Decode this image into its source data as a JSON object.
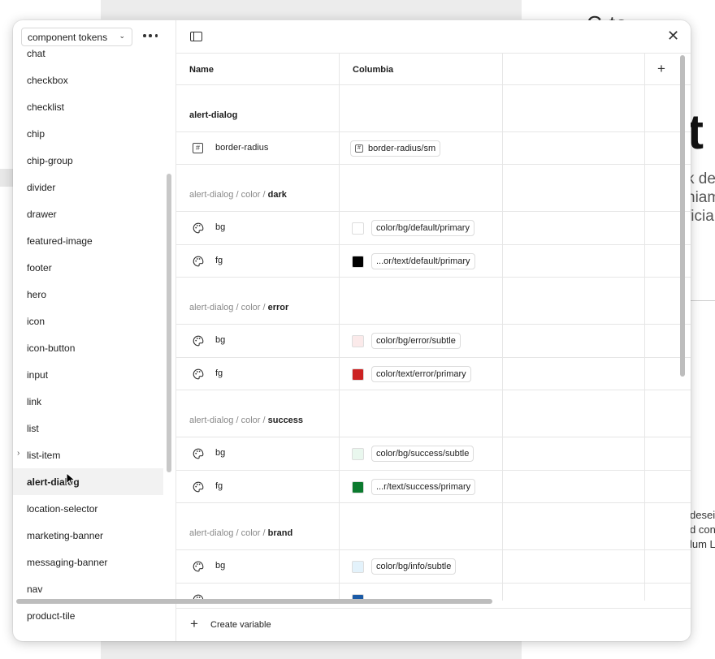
{
  "background": {
    "title": "C          ts",
    "big_char": "t",
    "desc_lines": [
      "k de",
      "niam",
      "ficia"
    ],
    "small_lines": [
      "desei",
      "d con",
      "lum L"
    ]
  },
  "sidebar": {
    "collection": "component tokens",
    "groups": [
      {
        "label": "chat"
      },
      {
        "label": "checkbox"
      },
      {
        "label": "checklist"
      },
      {
        "label": "chip"
      },
      {
        "label": "chip-group"
      },
      {
        "label": "divider"
      },
      {
        "label": "drawer"
      },
      {
        "label": "featured-image"
      },
      {
        "label": "footer"
      },
      {
        "label": "hero"
      },
      {
        "label": "icon"
      },
      {
        "label": "icon-button"
      },
      {
        "label": "input"
      },
      {
        "label": "link"
      },
      {
        "label": "list"
      },
      {
        "label": "list-item",
        "expandable": true
      },
      {
        "label": "alert-dialog",
        "active": true
      },
      {
        "label": "location-selector"
      },
      {
        "label": "marketing-banner"
      },
      {
        "label": "messaging-banner"
      },
      {
        "label": "nav"
      },
      {
        "label": "product-tile"
      }
    ]
  },
  "table": {
    "columns": [
      "Name",
      "Columbia"
    ],
    "groups": [
      {
        "title_prefix": "",
        "title_bold": "alert-dialog",
        "rows": [
          {
            "name": "border-radius",
            "type": "number",
            "value": "border-radius/sm"
          }
        ]
      },
      {
        "title_prefix": "alert-dialog / color / ",
        "title_bold": "dark",
        "rows": [
          {
            "name": "bg",
            "type": "color",
            "value": "color/bg/default/primary",
            "swatch": "#ffffff"
          },
          {
            "name": "fg",
            "type": "color",
            "value": "...or/text/default/primary",
            "swatch": "#000000"
          }
        ]
      },
      {
        "title_prefix": "alert-dialog / color / ",
        "title_bold": "error",
        "rows": [
          {
            "name": "bg",
            "type": "color",
            "value": "color/bg/error/subtle",
            "swatch": "#fbeaea"
          },
          {
            "name": "fg",
            "type": "color",
            "value": "color/text/error/primary",
            "swatch": "#cc2222"
          }
        ]
      },
      {
        "title_prefix": "alert-dialog / color / ",
        "title_bold": "success",
        "rows": [
          {
            "name": "bg",
            "type": "color",
            "value": "color/bg/success/subtle",
            "swatch": "#e9f7ee"
          },
          {
            "name": "fg",
            "type": "color",
            "value": "...r/text/success/primary",
            "swatch": "#0b7a2e"
          }
        ]
      },
      {
        "title_prefix": "alert-dialog / color / ",
        "title_bold": "brand",
        "rows": [
          {
            "name": "bg",
            "type": "color",
            "value": "color/bg/info/subtle",
            "swatch": "#e3f2fb"
          },
          {
            "name": "",
            "type": "color",
            "value": "",
            "swatch": "#1a5aa6"
          }
        ]
      }
    ]
  },
  "footer": {
    "create_label": "Create variable"
  }
}
